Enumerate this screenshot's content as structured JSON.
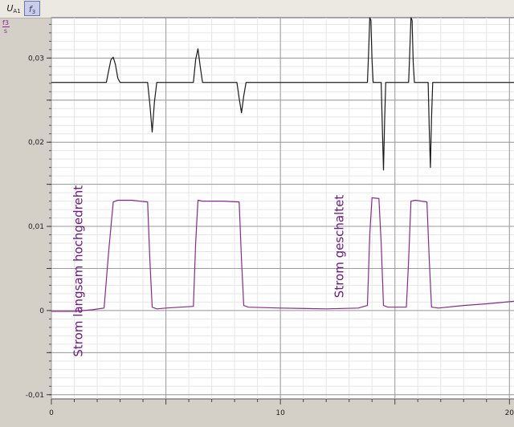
{
  "toolbar": {
    "channel1_label": "U",
    "channel1_sub": "A1",
    "channel2_label": "f",
    "channel2_sub": "3"
  },
  "unit": {
    "numerator": "f3",
    "denominator": "s"
  },
  "chart_data": {
    "type": "line",
    "title": "",
    "xlabel": "",
    "ylabel": "",
    "xlim": [
      0,
      20.2
    ],
    "ylim": [
      -0.0105,
      0.0348
    ],
    "grid": true,
    "x_ticks": [
      0,
      10,
      20
    ],
    "x_tick_labels": [
      "0",
      "10",
      "20"
    ],
    "y_ticks": [
      -0.01,
      0,
      0.01,
      0.02,
      0.03
    ],
    "y_tick_labels": [
      "-0,01",
      "0",
      "0,01",
      "0,02",
      "0,03"
    ],
    "series": [
      {
        "color": "#1a1a1a",
        "x": [
          0,
          2.4,
          2.5,
          2.6,
          2.7,
          2.8,
          2.9,
          3.0,
          4.2,
          4.3,
          4.4,
          4.5,
          4.6,
          6.2,
          6.3,
          6.4,
          6.5,
          6.6,
          8.1,
          8.2,
          8.3,
          8.4,
          8.5,
          13.8,
          13.85,
          13.9,
          13.95,
          14.0,
          14.05,
          14.4,
          14.45,
          14.5,
          14.55,
          14.6,
          15.6,
          15.65,
          15.7,
          15.75,
          15.8,
          15.85,
          16.45,
          16.5,
          16.55,
          16.6,
          16.65,
          20.2
        ],
        "y": [
          0.0271,
          0.0271,
          0.0285,
          0.0298,
          0.0301,
          0.0292,
          0.0276,
          0.0271,
          0.0271,
          0.0245,
          0.0212,
          0.0248,
          0.0271,
          0.0271,
          0.0298,
          0.0311,
          0.029,
          0.0271,
          0.0271,
          0.0252,
          0.0235,
          0.0255,
          0.0271,
          0.0271,
          0.0305,
          0.0348,
          0.0345,
          0.0298,
          0.0271,
          0.0271,
          0.022,
          0.0167,
          0.0225,
          0.0271,
          0.0271,
          0.031,
          0.0348,
          0.0345,
          0.0295,
          0.0271,
          0.0271,
          0.0215,
          0.017,
          0.0228,
          0.0271,
          0.0271
        ]
      },
      {
        "color": "#8a2a8a",
        "x": [
          0,
          1.0,
          1.8,
          2.3,
          2.5,
          2.7,
          2.9,
          3.5,
          4.2,
          4.3,
          4.4,
          4.6,
          5.0,
          6.2,
          6.3,
          6.4,
          6.6,
          7.5,
          8.2,
          8.3,
          8.4,
          8.6,
          10.0,
          12.0,
          13.4,
          13.8,
          13.9,
          14.0,
          14.3,
          14.4,
          14.5,
          14.7,
          15.5,
          15.6,
          15.7,
          15.9,
          16.4,
          16.5,
          16.6,
          16.9,
          18.0,
          19.0,
          20.2
        ],
        "y": [
          -0.0001,
          -0.0001,
          0.0001,
          0.0003,
          0.007,
          0.0129,
          0.0131,
          0.0131,
          0.0129,
          0.006,
          0.0004,
          0.0002,
          0.0003,
          0.0005,
          0.008,
          0.0131,
          0.013,
          0.013,
          0.0129,
          0.006,
          0.0006,
          0.0004,
          0.0003,
          0.0002,
          0.0003,
          0.0006,
          0.009,
          0.0134,
          0.0133,
          0.008,
          0.0006,
          0.0004,
          0.0004,
          0.006,
          0.013,
          0.0131,
          0.0129,
          0.006,
          0.0004,
          0.0003,
          0.0006,
          0.0008,
          0.0011
        ]
      }
    ],
    "annotations": [
      {
        "text": "Strom langsam hochgedreht",
        "x": 1.35,
        "y": -0.0055,
        "rotation": -90
      },
      {
        "text": "Strom geschaltet",
        "x": 12.75,
        "y": 0.0015,
        "rotation": -90
      }
    ]
  }
}
